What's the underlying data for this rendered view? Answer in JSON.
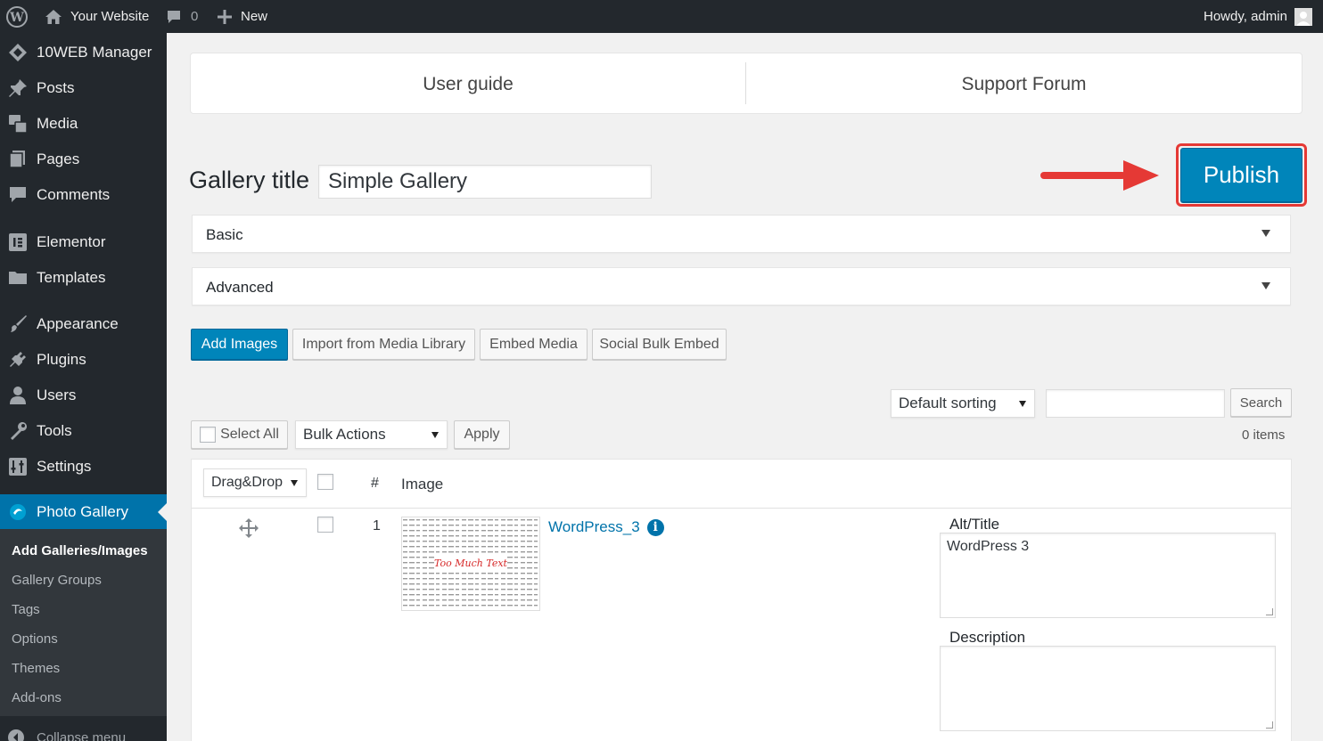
{
  "adminbar": {
    "site_name": "Your Website",
    "comments_count": "0",
    "new_label": "New",
    "greeting": "Howdy, admin"
  },
  "sidebar": {
    "items": [
      {
        "label": "10WEB Manager",
        "icon": "tenweb-icon"
      },
      {
        "label": "Posts",
        "icon": "pin-icon"
      },
      {
        "label": "Media",
        "icon": "media-icon"
      },
      {
        "label": "Pages",
        "icon": "pages-icon"
      },
      {
        "label": "Comments",
        "icon": "comment-icon"
      },
      {
        "label": "Elementor",
        "icon": "elementor-icon"
      },
      {
        "label": "Templates",
        "icon": "folder-icon"
      },
      {
        "label": "Appearance",
        "icon": "brush-icon"
      },
      {
        "label": "Plugins",
        "icon": "plugin-icon"
      },
      {
        "label": "Users",
        "icon": "user-icon"
      },
      {
        "label": "Tools",
        "icon": "wrench-icon"
      },
      {
        "label": "Settings",
        "icon": "settings-icon"
      },
      {
        "label": "Photo Gallery",
        "icon": "photo-gallery-icon"
      }
    ],
    "submenu": [
      "Add Galleries/Images",
      "Gallery Groups",
      "Tags",
      "Options",
      "Themes",
      "Add-ons"
    ],
    "collapse_label": "Collapse menu"
  },
  "toplinks": {
    "user_guide": "User guide",
    "support_forum": "Support Forum"
  },
  "gallery": {
    "title_label": "Gallery title",
    "title_value": "Simple Gallery",
    "publish_label": "Publish"
  },
  "sections": {
    "basic": "Basic",
    "advanced": "Advanced"
  },
  "actions": {
    "add_images": "Add Images",
    "import_media": "Import from Media Library",
    "embed_media": "Embed Media",
    "social_bulk": "Social Bulk Embed"
  },
  "filters": {
    "sorting": "Default sorting",
    "search_button": "Search",
    "select_all": "Select All",
    "bulk_actions": "Bulk Actions",
    "apply": "Apply",
    "items_count": "0 items"
  },
  "table": {
    "order_select": "Drag&Drop",
    "col_number": "#",
    "col_image": "Image",
    "rows": [
      {
        "number": "1",
        "name": "WordPress_3",
        "thumbnail_text": "Too Much Text",
        "alt_label": "Alt/Title",
        "alt_value": "WordPress 3",
        "description_label": "Description",
        "description_value": ""
      }
    ]
  },
  "colors": {
    "admin_dark": "#23282d",
    "accent_blue": "#0085ba",
    "highlight_red": "#e53935"
  }
}
